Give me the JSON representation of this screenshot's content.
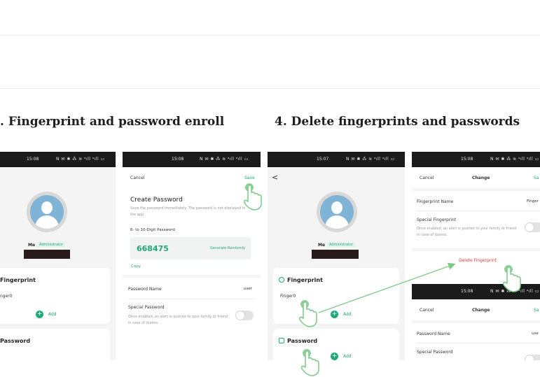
{
  "headings": {
    "left": ". Fingerprint and password enroll",
    "right": "4. Delete fingerprints and passwords"
  },
  "status": {
    "p1_time": "15:08",
    "p2_time": "15:08",
    "p3_time": "15:07",
    "p4_time": "15:08",
    "p5_time": "15:08",
    "icons": "N ✉ ✱ ⁂ ≋ ᵃıll ᵃıll ▭"
  },
  "profile": {
    "name": "Me",
    "role": "Administrator"
  },
  "screen1": {
    "fingerprint_title": "Fingerprint",
    "finger_item": "nger0",
    "add": "Add",
    "password_title": "Password"
  },
  "screen2": {
    "cancel": "Cancel",
    "save": "Save",
    "title": "Create Password",
    "note": "Save the password immediately. The password is not displayed in the app.",
    "digits_label": "6- to 10-Digit Password",
    "password_value": "668475",
    "generate": "Generate Randomly",
    "copy": "Copy",
    "pwname_label": "Password Name",
    "pwname_value": "user",
    "special_title": "Special Password",
    "special_desc": "Once enabled, an alert is pushed to your family or friend in case of duress."
  },
  "screen3": {
    "back": "<",
    "fingerprint_title": "Fingerprint",
    "finger_item": "Finger0",
    "add": "Add",
    "password_title": "Password",
    "add2": "Add"
  },
  "screen4": {
    "cancel": "Cancel",
    "title": "Change",
    "save": "Sa",
    "fpname_label": "Fingerprint Name",
    "fpname_value": "Finger",
    "special_title": "Special Fingerprint",
    "special_desc": "Once enabled, an alert is pushed to your family or friend in case of duress.",
    "delete": "Delete Fingerprint"
  },
  "screen5": {
    "cancel": "Cancel",
    "title": "Change",
    "save": "Sa",
    "pwname_label": "Password Name",
    "pwname_value": "use",
    "special_title": "Special Password"
  },
  "colors": {
    "accent": "#1fa87a",
    "danger": "#e03a3a",
    "hand": "#7cc98a"
  }
}
